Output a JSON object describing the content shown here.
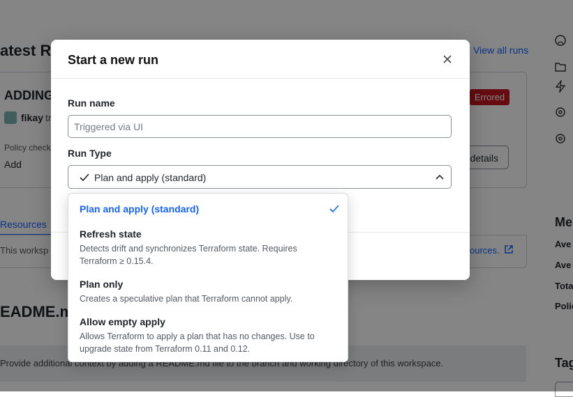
{
  "background": {
    "heading_latest": "atest Ru",
    "view_all_runs": "View all runs",
    "run_title": "ADDING",
    "user": "fikay",
    "user_suffix": "tr",
    "errored_badge": "Errored",
    "policy_checks": "Policy checks",
    "add": "Add",
    "details_button": "details",
    "tab_resources": "Resources",
    "workspace_text": "This worksp",
    "resources_link": "ources.",
    "readme_heading": "EADME.md",
    "readme_hint": "Provide additional context by adding a README.md file to the branch and working directory of this workspace.",
    "metrics_heading": "Me",
    "metrics_rows": [
      "Ave",
      "Ave",
      "Tota",
      "Polic"
    ],
    "tags_heading": "Tag"
  },
  "modal": {
    "title": "Start a new run",
    "run_name_label": "Run name",
    "run_name_placeholder": "Triggered via UI",
    "run_type_label": "Run Type",
    "run_type_selected": "Plan and apply (standard)"
  },
  "menu": {
    "options": [
      {
        "title": "Plan and apply (standard)",
        "description": "",
        "selected": true
      },
      {
        "title": "Refresh state",
        "description": "Detects drift and synchronizes Terraform state. Requires Terraform ≥ 0.15.4.",
        "selected": false
      },
      {
        "title": "Plan only",
        "description": "Creates a speculative plan that Terraform cannot apply.",
        "selected": false
      },
      {
        "title": "Allow empty apply",
        "description": "Allows Terraform to apply a plan that has no changes. Use to upgrade state from Terraform 0.11 and 0.12.",
        "selected": false
      }
    ]
  },
  "colors": {
    "accent": "#1563ff",
    "error": "#c4171f",
    "overlay": "rgba(0,0,0,0.48)"
  }
}
